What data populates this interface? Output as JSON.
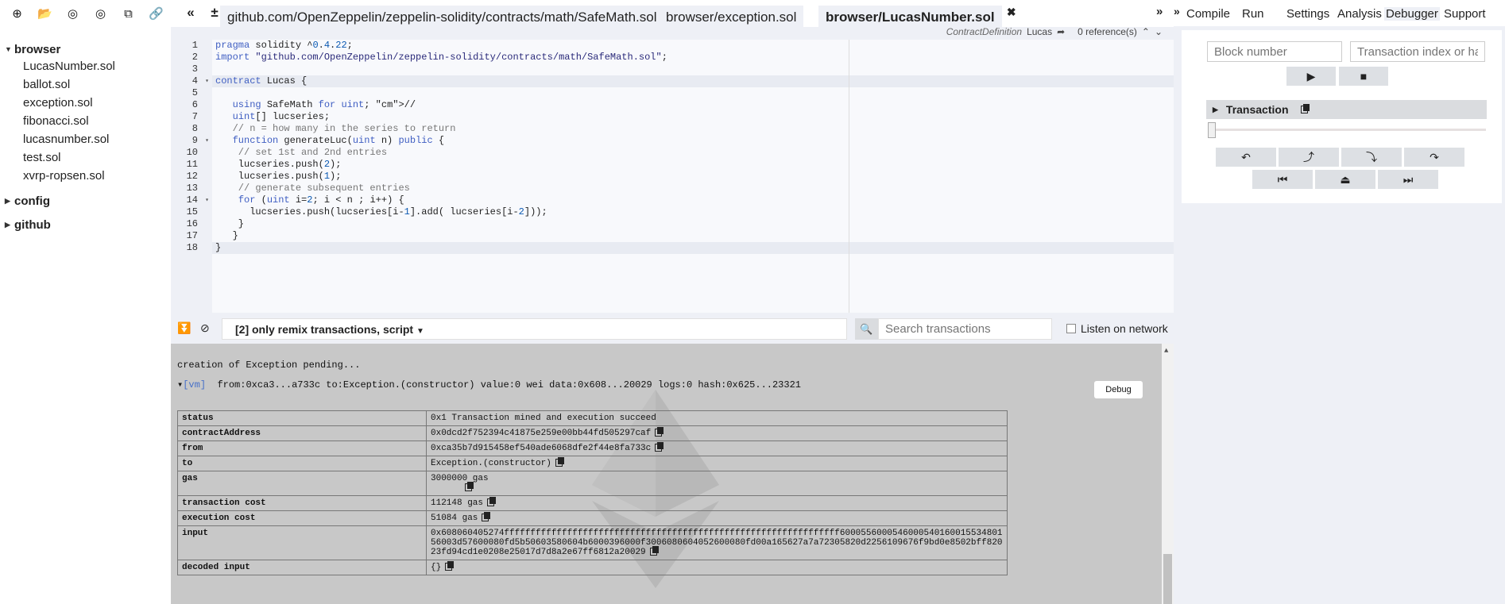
{
  "file_explorer": {
    "toolbar_icons": [
      "add-file-icon",
      "open-folder-icon",
      "github-icon",
      "gist-icon",
      "copy-icon",
      "link-icon"
    ],
    "folders": [
      {
        "name": "browser",
        "expanded": true,
        "files": [
          "LucasNumber.sol",
          "ballot.sol",
          "exception.sol",
          "fibonacci.sol",
          "lucasnumber.sol",
          "test.sol",
          "xvrp-ropsen.sol"
        ]
      },
      {
        "name": "config",
        "expanded": false,
        "files": []
      },
      {
        "name": "github",
        "expanded": false,
        "files": []
      }
    ]
  },
  "tabs": [
    {
      "label": "github.com/OpenZeppelin/zeppelin-solidity/contracts/math/SafeMath.sol",
      "active": false
    },
    {
      "label": "browser/exception.sol",
      "active": false
    },
    {
      "label": "browser/LucasNumber.sol",
      "active": true
    }
  ],
  "context": {
    "kind": "ContractDefinition",
    "name": "Lucas",
    "references": "0 reference(s)"
  },
  "editor": {
    "lines": [
      "pragma solidity ^0.4.22;",
      "import \"github.com/OpenZeppelin/zeppelin-solidity/contracts/math/SafeMath.sol\";",
      "",
      "contract Lucas {",
      "",
      "   using SafeMath for uint; //",
      "   uint[] lucseries;",
      "   // n = how many in the series to return",
      "   function generateLuc(uint n) public {",
      "    // set 1st and 2nd entries",
      "    lucseries.push(2);",
      "    lucseries.push(1);",
      "    // generate subsequent entries",
      "    for (uint i=2; i < n ; i++) {",
      "      lucseries.push(lucseries[i-1].add( lucseries[i-2]));",
      "    }",
      "   }",
      "}"
    ],
    "fold_lines": [
      4,
      9,
      14
    ]
  },
  "terminal": {
    "filter": "[2] only remix transactions, script",
    "search_placeholder": "Search transactions",
    "listen_label": "Listen on network",
    "pending": "creation of Exception pending...",
    "tx": {
      "tag": "[vm]",
      "summary": "from:0xca3...a733c to:Exception.(constructor) value:0 wei data:0x608...20029 logs:0 hash:0x625...23321",
      "debug_label": "Debug"
    },
    "details": [
      {
        "key": "status",
        "value": "0x1 Transaction mined and execution succeed",
        "copy": false
      },
      {
        "key": "contractAddress",
        "value": "0x0dcd2f752394c41875e259e00bb44fd505297caf",
        "copy": true
      },
      {
        "key": "from",
        "value": "0xca35b7d915458ef540ade6068dfe2f44e8fa733c",
        "copy": true
      },
      {
        "key": "to",
        "value": "Exception.(constructor)",
        "copy": true
      },
      {
        "key": "gas",
        "value": "3000000 gas",
        "copy": true
      },
      {
        "key": "transaction cost",
        "value": "112148 gas",
        "copy": true
      },
      {
        "key": "execution cost",
        "value": "51084 gas",
        "copy": true
      },
      {
        "key": "input",
        "value": "0x608060405274ffffffffffffffffffffffffffffffffffffffffffffffffffffffffffffffff600055600054600054016001553480156003d57600080fd5b50603580604b6000396000f3006080604052600080fd00a165627a7a72305820d2256109676f9bd0e8502bff82023fd94cd1e0208e25017d7d8a2e67ff6812a20029",
        "copy": true
      },
      {
        "key": "decoded input",
        "value": "{}",
        "copy": true
      }
    ]
  },
  "right_panel": {
    "tabs": [
      "Compile",
      "Run",
      "Settings",
      "Analysis",
      "Debugger",
      "Support"
    ],
    "active_tab": "Debugger",
    "block_placeholder": "Block number",
    "tx_placeholder": "Transaction index or hash",
    "transaction_label": "Transaction",
    "slider_fraction": 0
  }
}
